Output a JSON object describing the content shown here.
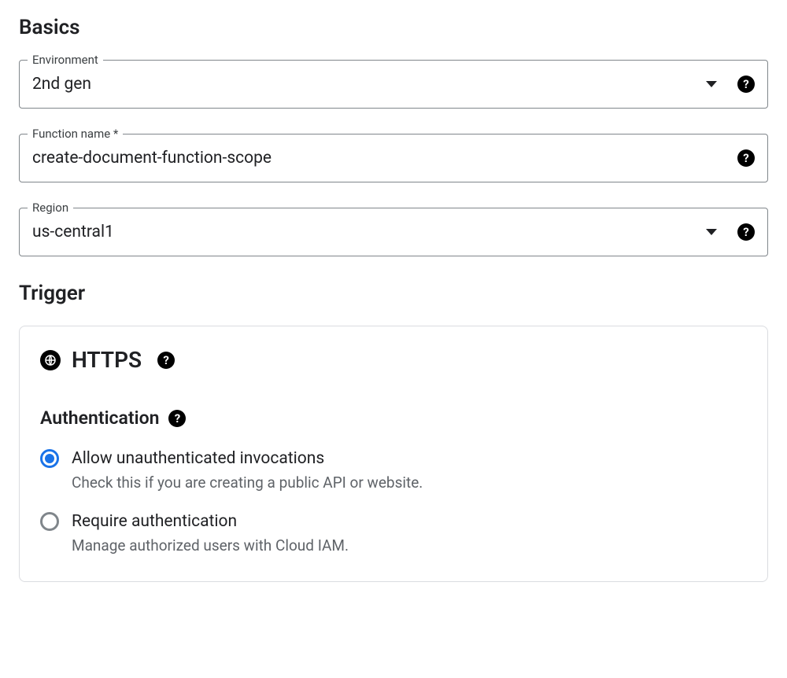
{
  "basics": {
    "heading": "Basics",
    "environment": {
      "label": "Environment",
      "value": "2nd gen"
    },
    "function_name": {
      "label": "Function name *",
      "value": "create-document-function-scope"
    },
    "region": {
      "label": "Region",
      "value": "us-central1"
    }
  },
  "trigger": {
    "heading": "Trigger",
    "type_label": "HTTPS",
    "authentication": {
      "heading": "Authentication",
      "options": [
        {
          "label": "Allow unauthenticated invocations",
          "description": "Check this if you are creating a public API or website.",
          "selected": true
        },
        {
          "label": "Require authentication",
          "description": "Manage authorized users with Cloud IAM.",
          "selected": false
        }
      ]
    }
  }
}
